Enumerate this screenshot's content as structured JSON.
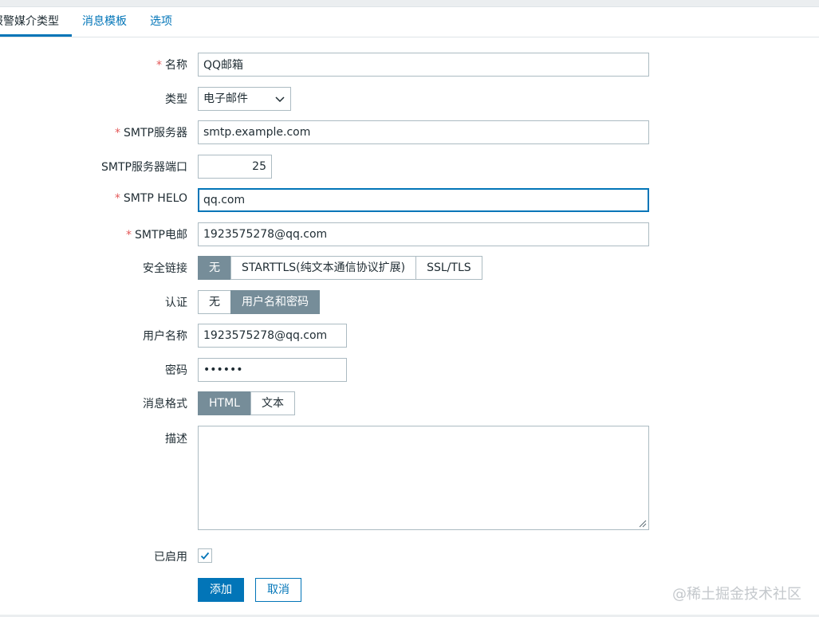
{
  "tabs": [
    {
      "label": "报警媒介类型",
      "active": true
    },
    {
      "label": "消息模板",
      "active": false
    },
    {
      "label": "选项",
      "active": false
    }
  ],
  "form": {
    "name": {
      "label": "名称",
      "required": true,
      "value": "QQ邮箱"
    },
    "type": {
      "label": "类型",
      "value": "电子邮件"
    },
    "smtp_server": {
      "label": "SMTP服务器",
      "required": true,
      "value": "smtp.example.com"
    },
    "smtp_port": {
      "label": "SMTP服务器端口",
      "value": "25"
    },
    "smtp_helo": {
      "label": "SMTP HELO",
      "required": true,
      "value": "qq.com"
    },
    "smtp_email": {
      "label": "SMTP电邮",
      "required": true,
      "value": "1923575278@qq.com"
    },
    "security": {
      "label": "安全链接",
      "options": [
        "无",
        "STARTTLS(纯文本通信协议扩展)",
        "SSL/TLS"
      ],
      "selected": "无"
    },
    "auth": {
      "label": "认证",
      "options": [
        "无",
        "用户名和密码"
      ],
      "selected": "用户名和密码"
    },
    "username": {
      "label": "用户名称",
      "value": "1923575278@qq.com"
    },
    "password": {
      "label": "密码",
      "value": "••••••"
    },
    "message_format": {
      "label": "消息格式",
      "options": [
        "HTML",
        "文本"
      ],
      "selected": "HTML"
    },
    "description": {
      "label": "描述",
      "value": ""
    },
    "enabled": {
      "label": "已启用",
      "checked": true
    }
  },
  "buttons": {
    "add": "添加",
    "cancel": "取消"
  },
  "watermark": "@稀土掘金技术社区",
  "colors": {
    "accent": "#0275b8",
    "segment_on": "#768d99",
    "required": "#e45959"
  }
}
